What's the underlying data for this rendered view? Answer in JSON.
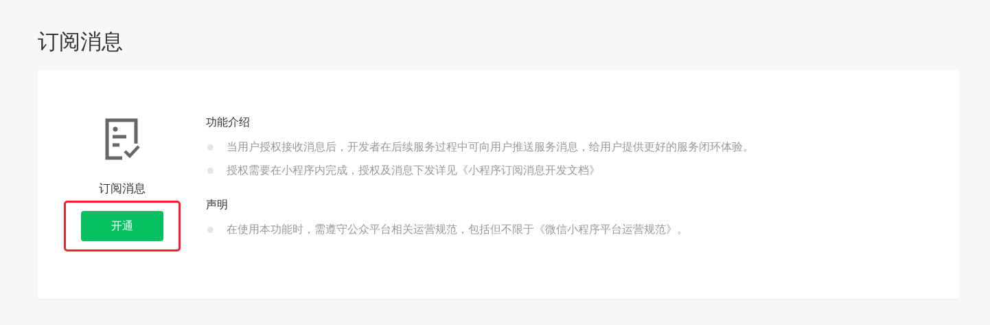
{
  "page_title": "订阅消息",
  "feature": {
    "name": "订阅消息",
    "button": {
      "label": "开通",
      "highlighted": true
    }
  },
  "sections": [
    {
      "heading": "功能介绍",
      "items": [
        "当用户授权接收消息后，开发者在后续服务过程中可向用户推送服务消息，给用户提供更好的服务闭环体验。",
        "授权需要在小程序内完成，授权及消息下发详见《小程序订阅消息开发文档》"
      ]
    },
    {
      "heading": "声明",
      "items": [
        "在使用本功能时，需遵守公众平台相关运营规范，包括但不限于《微信小程序平台运营规范》。"
      ]
    }
  ]
}
